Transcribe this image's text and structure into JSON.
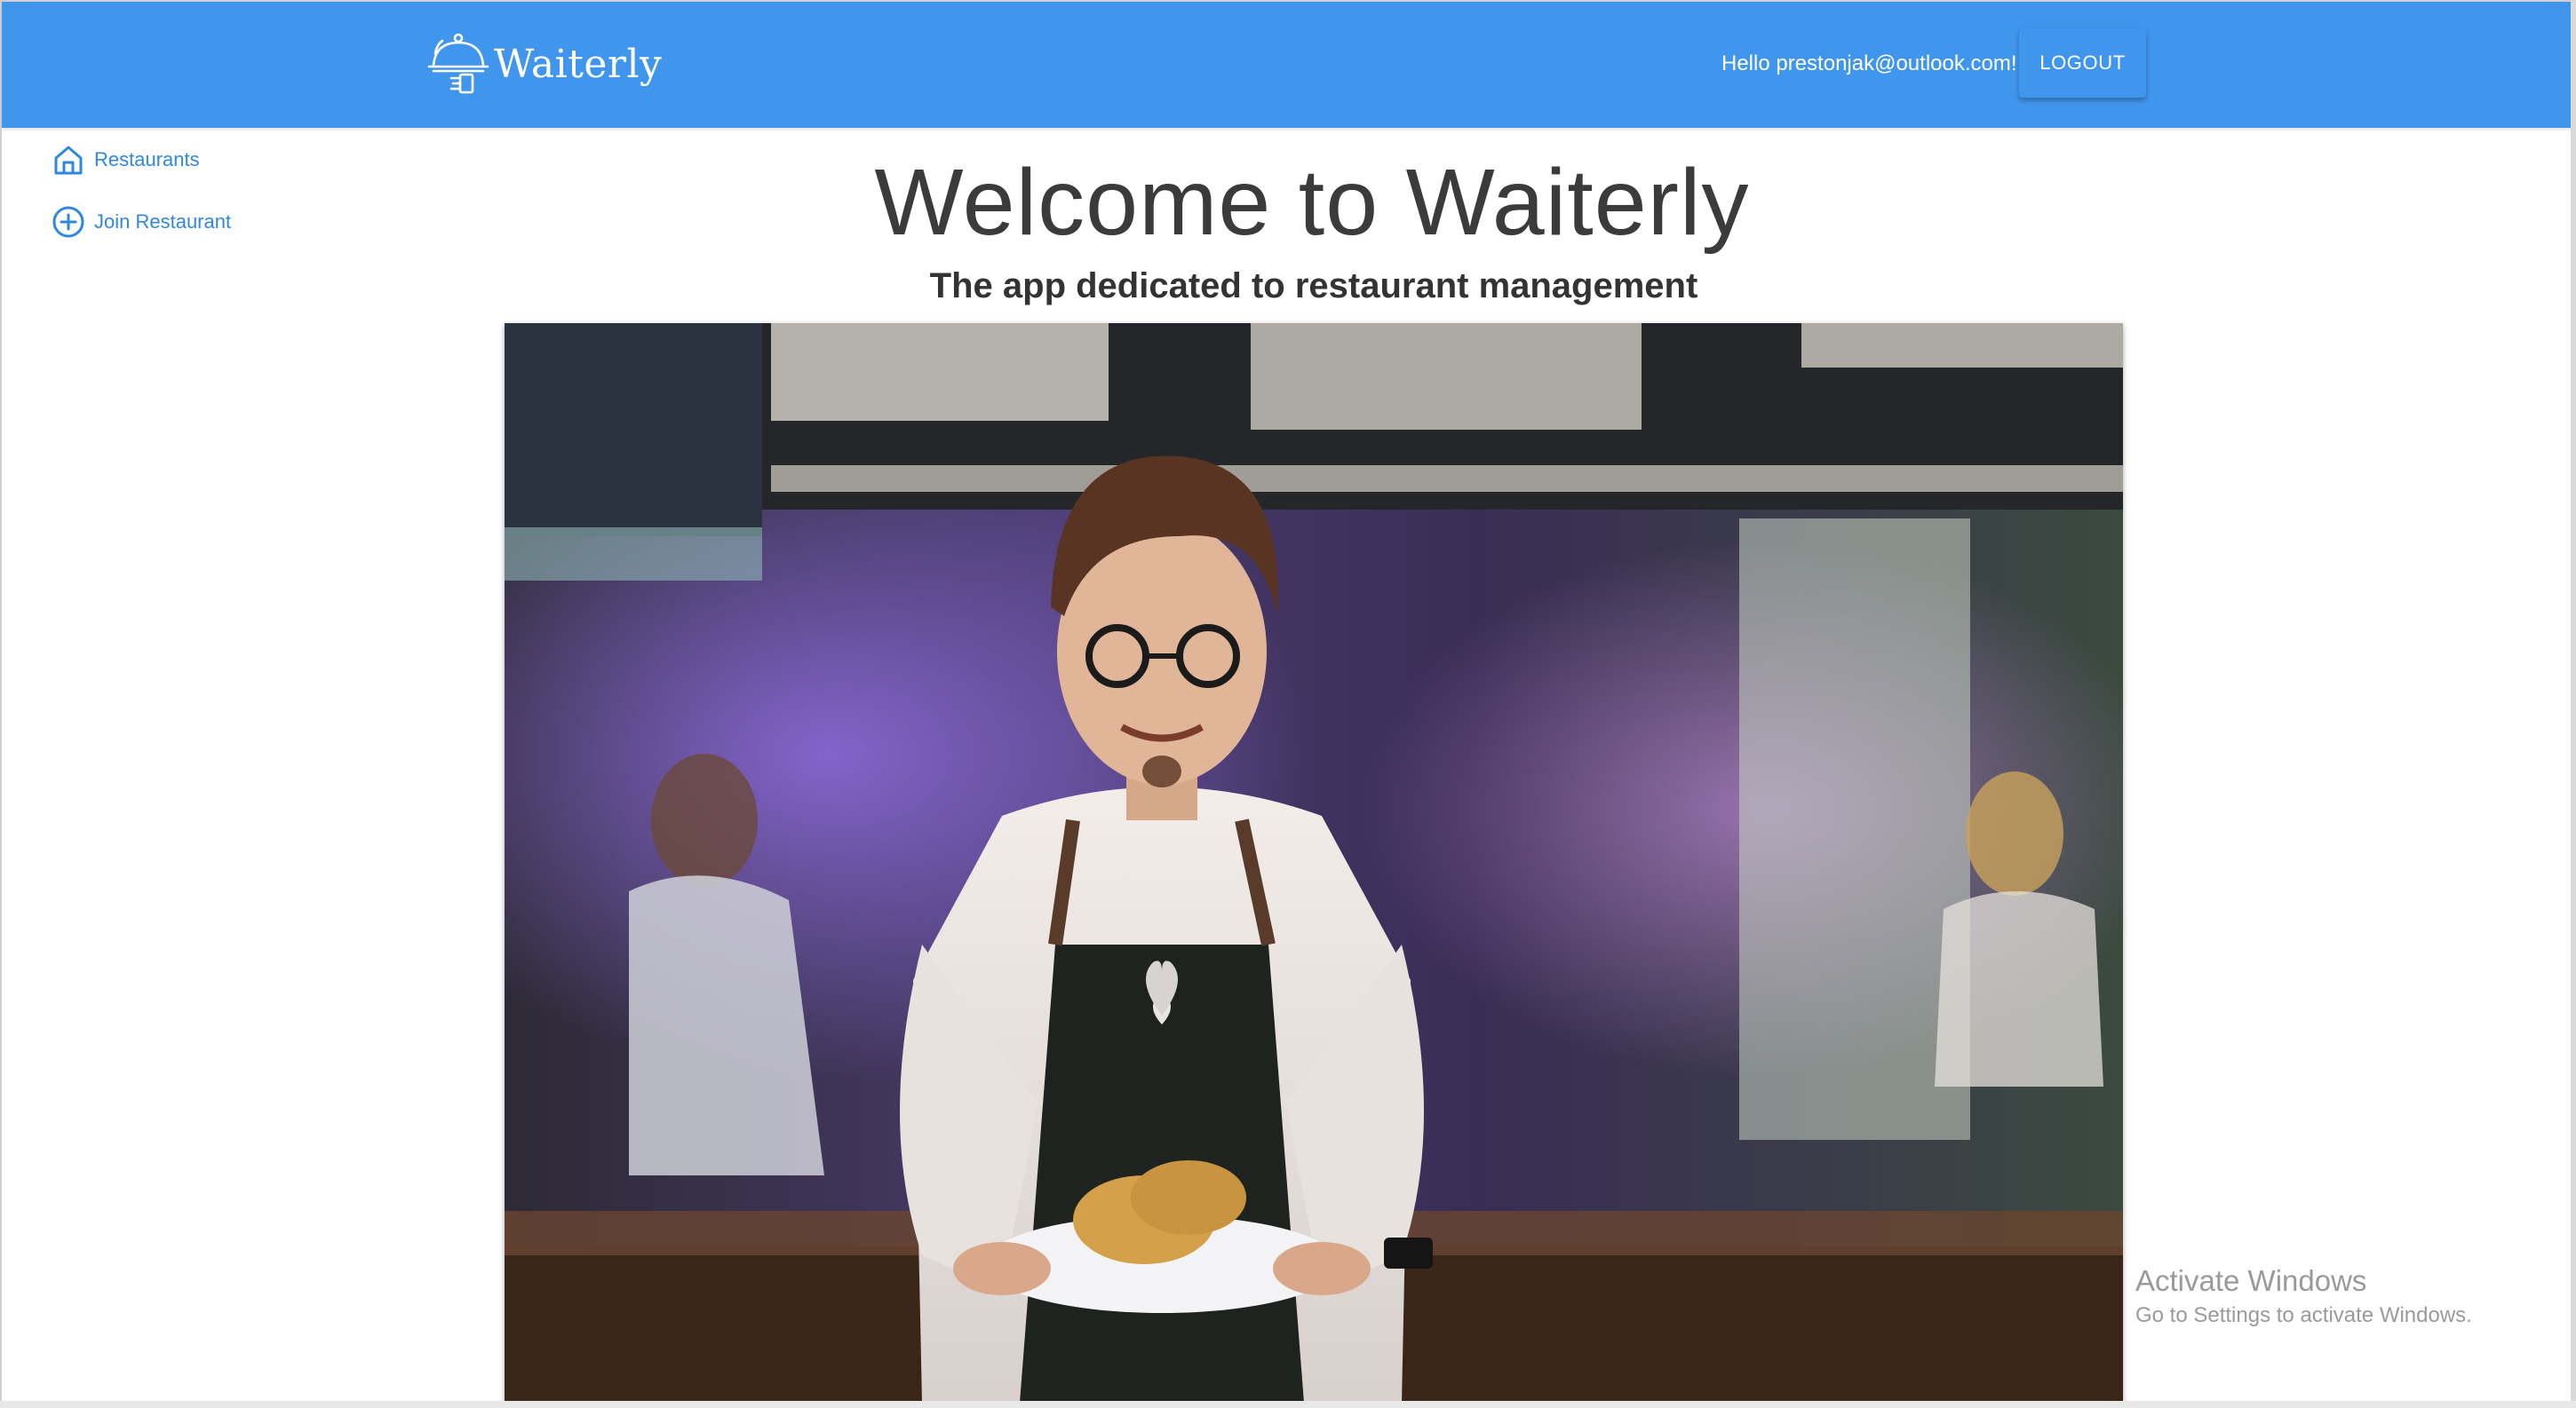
{
  "header": {
    "brand": "Waiterly",
    "greeting": "Hello prestonjak@outlook.com!",
    "logout_label": "LOGOUT",
    "background": "#4096ed"
  },
  "sidebar": {
    "items": [
      {
        "label": "Restaurants",
        "icon": "home-icon"
      },
      {
        "label": "Join Restaurant",
        "icon": "add-circle-icon"
      }
    ]
  },
  "main": {
    "title": "Welcome to Waiterly",
    "subtitle": "The app dedicated to restaurant management"
  },
  "watermark": {
    "title": "Activate Windows",
    "subtitle": "Go to Settings to activate Windows."
  },
  "colors": {
    "accent": "#4096ed",
    "link": "#2f88dd"
  }
}
